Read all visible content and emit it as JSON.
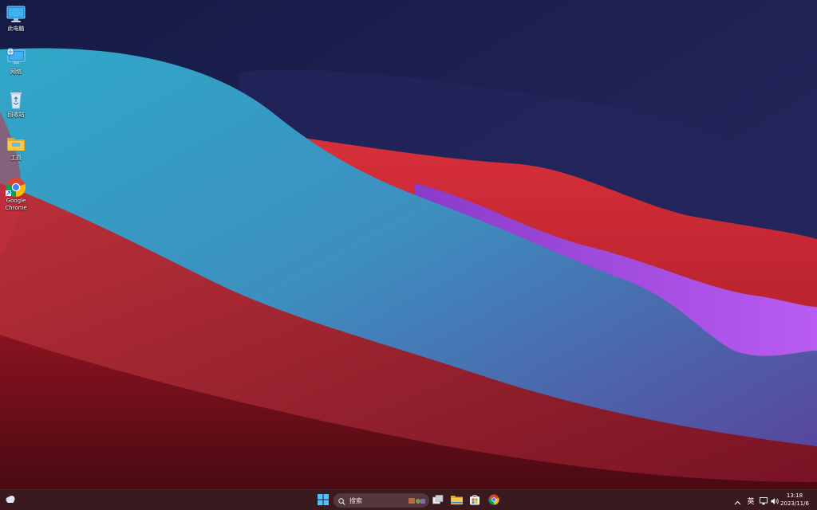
{
  "desktop": {
    "icons": [
      {
        "name": "computer-icon",
        "label": "此电脑"
      },
      {
        "name": "network-icon",
        "label": "网络"
      },
      {
        "name": "recycle-bin-icon",
        "label": "回收站"
      },
      {
        "name": "folder-icon",
        "label": "工具"
      },
      {
        "name": "chrome-icon",
        "label": "Google Chrome"
      }
    ]
  },
  "taskbar": {
    "search_label": "搜索",
    "tray": {
      "ime": "英",
      "time": "13:18",
      "date": "2023/11/6"
    },
    "pinned": [
      "start-icon",
      "task-view-icon",
      "file-explorer-icon",
      "store-icon",
      "chrome-icon"
    ],
    "colors": {
      "taskbar_bg": "#3a1a1f",
      "start_blue": "#4cc2ff",
      "folder_yellow": "#f7c948"
    }
  }
}
